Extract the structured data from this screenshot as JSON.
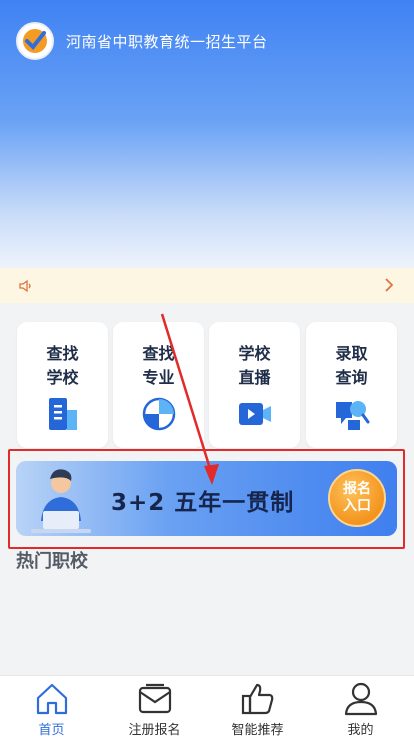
{
  "header": {
    "title": "河南省中职教育统一招生平台"
  },
  "cards": [
    {
      "line1": "查找",
      "line2": "学校",
      "icon": "school-building-icon"
    },
    {
      "line1": "查找",
      "line2": "专业",
      "icon": "pie-chart-icon"
    },
    {
      "line1": "学校",
      "line2": "直播",
      "icon": "video-camera-icon"
    },
    {
      "line1": "录取",
      "line2": "查询",
      "icon": "search-document-icon"
    }
  ],
  "banner": {
    "text": "3+2 五年一贯制",
    "button_line1": "报名",
    "button_line2": "入口"
  },
  "section": {
    "title": "热门职校"
  },
  "tabs": [
    {
      "label": "首页",
      "icon": "home-icon",
      "active": true
    },
    {
      "label": "注册报名",
      "icon": "mail-icon",
      "active": false
    },
    {
      "label": "智能推荐",
      "icon": "thumbs-up-icon",
      "active": false
    },
    {
      "label": "我的",
      "icon": "user-icon",
      "active": false
    }
  ],
  "colors": {
    "primary": "#3f82f3",
    "highlight_frame": "#e12a2a",
    "annotation_arrow": "#e12a2a",
    "tab_active": "#2f6ddb"
  }
}
